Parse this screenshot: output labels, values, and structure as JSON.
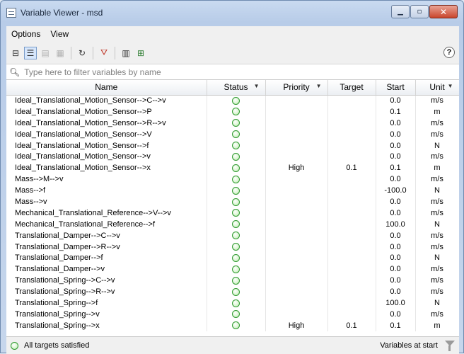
{
  "window": {
    "title": "Variable Viewer - msd"
  },
  "menu": [
    "Options",
    "View"
  ],
  "toolbar": {
    "help_label": "?"
  },
  "filter": {
    "placeholder": "Type here to filter variables by name"
  },
  "columns": {
    "name": "Name",
    "status": "Status",
    "priority": "Priority",
    "target": "Target",
    "start": "Start",
    "unit": "Unit"
  },
  "status_color": "#2f9a2f",
  "rows": [
    {
      "name": "Ideal_Translational_Motion_Sensor-->C-->v",
      "priority": "",
      "target": "",
      "start": "0.0",
      "unit": "m/s"
    },
    {
      "name": "Ideal_Translational_Motion_Sensor-->P",
      "priority": "",
      "target": "",
      "start": "0.1",
      "unit": "m"
    },
    {
      "name": "Ideal_Translational_Motion_Sensor-->R-->v",
      "priority": "",
      "target": "",
      "start": "0.0",
      "unit": "m/s"
    },
    {
      "name": "Ideal_Translational_Motion_Sensor-->V",
      "priority": "",
      "target": "",
      "start": "0.0",
      "unit": "m/s"
    },
    {
      "name": "Ideal_Translational_Motion_Sensor-->f",
      "priority": "",
      "target": "",
      "start": "0.0",
      "unit": "N"
    },
    {
      "name": "Ideal_Translational_Motion_Sensor-->v",
      "priority": "",
      "target": "",
      "start": "0.0",
      "unit": "m/s"
    },
    {
      "name": "Ideal_Translational_Motion_Sensor-->x",
      "priority": "High",
      "target": "0.1",
      "start": "0.1",
      "unit": "m"
    },
    {
      "name": "Mass-->M-->v",
      "priority": "",
      "target": "",
      "start": "0.0",
      "unit": "m/s"
    },
    {
      "name": "Mass-->f",
      "priority": "",
      "target": "",
      "start": "-100.0",
      "unit": "N"
    },
    {
      "name": "Mass-->v",
      "priority": "",
      "target": "",
      "start": "0.0",
      "unit": "m/s"
    },
    {
      "name": "Mechanical_Translational_Reference-->V-->v",
      "priority": "",
      "target": "",
      "start": "0.0",
      "unit": "m/s"
    },
    {
      "name": "Mechanical_Translational_Reference-->f",
      "priority": "",
      "target": "",
      "start": "100.0",
      "unit": "N"
    },
    {
      "name": "Translational_Damper-->C-->v",
      "priority": "",
      "target": "",
      "start": "0.0",
      "unit": "m/s"
    },
    {
      "name": "Translational_Damper-->R-->v",
      "priority": "",
      "target": "",
      "start": "0.0",
      "unit": "m/s"
    },
    {
      "name": "Translational_Damper-->f",
      "priority": "",
      "target": "",
      "start": "0.0",
      "unit": "N"
    },
    {
      "name": "Translational_Damper-->v",
      "priority": "",
      "target": "",
      "start": "0.0",
      "unit": "m/s"
    },
    {
      "name": "Translational_Spring-->C-->v",
      "priority": "",
      "target": "",
      "start": "0.0",
      "unit": "m/s"
    },
    {
      "name": "Translational_Spring-->R-->v",
      "priority": "",
      "target": "",
      "start": "0.0",
      "unit": "m/s"
    },
    {
      "name": "Translational_Spring-->f",
      "priority": "",
      "target": "",
      "start": "100.0",
      "unit": "N"
    },
    {
      "name": "Translational_Spring-->v",
      "priority": "",
      "target": "",
      "start": "0.0",
      "unit": "m/s"
    },
    {
      "name": "Translational_Spring-->x",
      "priority": "High",
      "target": "0.1",
      "start": "0.1",
      "unit": "m"
    }
  ],
  "statusbar": {
    "left": "All targets satisfied",
    "right": "Variables at start"
  }
}
